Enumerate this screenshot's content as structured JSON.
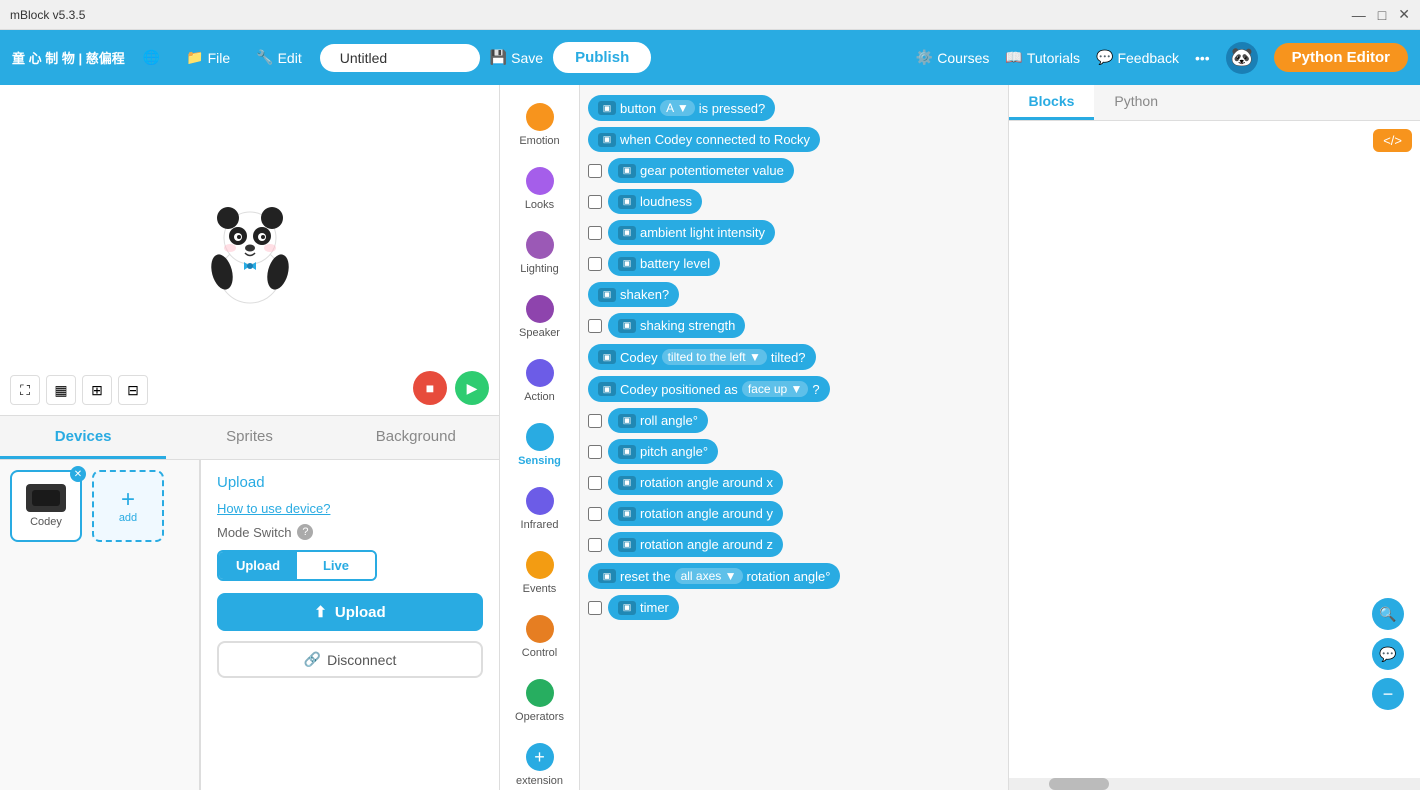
{
  "titlebar": {
    "app_name": "mBlock v5.3.5",
    "minimize": "—",
    "maximize": "□",
    "close": "✕"
  },
  "topnav": {
    "brand": "童 心 制 物 | 慈偏程",
    "globe_icon": "🌐",
    "file_label": "File",
    "edit_label": "Edit",
    "project_name": "Untitled",
    "save_label": "Save",
    "publish_label": "Publish",
    "courses_label": "Courses",
    "tutorials_label": "Tutorials",
    "feedback_label": "Feedback",
    "more_label": "•••",
    "python_editor_label": "Python Editor"
  },
  "canvas": {
    "stop_btn": "■",
    "run_btn": "▶"
  },
  "tabs": {
    "devices_label": "Devices",
    "sprites_label": "Sprites",
    "background_label": "Background"
  },
  "devices": {
    "codey_label": "Codey",
    "add_label": "add",
    "add_icon": "+"
  },
  "upload_panel": {
    "title": "Upload",
    "how_to_link": "How to use device?",
    "mode_switch": "Mode Switch",
    "upload_tab": "Upload",
    "live_tab": "Live",
    "upload_btn": "Upload",
    "disconnect_btn": "Disconnect"
  },
  "categories": [
    {
      "id": "emotion",
      "label": "Emotion",
      "color": "#f7941d"
    },
    {
      "id": "looks",
      "label": "Looks",
      "color": "#a55eea"
    },
    {
      "id": "lighting",
      "label": "Lighting",
      "color": "#9b59b6"
    },
    {
      "id": "speaker",
      "label": "Speaker",
      "color": "#8e44ad"
    },
    {
      "id": "action",
      "label": "Action",
      "color": "#6c5ce7"
    },
    {
      "id": "sensing",
      "label": "Sensing",
      "color": "#29abe2"
    },
    {
      "id": "infrared",
      "label": "Infrared",
      "color": "#6c5ce7"
    },
    {
      "id": "events",
      "label": "Events",
      "color": "#f39c12"
    },
    {
      "id": "control",
      "label": "Control",
      "color": "#e67e22"
    },
    {
      "id": "operators",
      "label": "Operators",
      "color": "#27ae60"
    },
    {
      "id": "extension",
      "label": "extension",
      "color": "#29abe2"
    }
  ],
  "blocks": [
    {
      "id": "btn-pressed",
      "type": "hat",
      "text": "button",
      "dropdown1": "A ▼",
      "extra": "is pressed?",
      "hasCheck": false
    },
    {
      "id": "when-connected",
      "type": "hat",
      "text": "when Codey connected to Rocky",
      "hasCheck": false
    },
    {
      "id": "gear-pot",
      "type": "sensing",
      "text": "gear potentiometer value",
      "hasCheck": true
    },
    {
      "id": "loudness",
      "type": "sensing",
      "text": "loudness",
      "hasCheck": true
    },
    {
      "id": "ambient",
      "type": "sensing",
      "text": "ambient light intensity",
      "hasCheck": true
    },
    {
      "id": "battery",
      "type": "sensing",
      "text": "battery level",
      "hasCheck": true
    },
    {
      "id": "shaken",
      "type": "hat",
      "text": "shaken?",
      "hasCheck": false
    },
    {
      "id": "shaking-strength",
      "type": "sensing",
      "text": "shaking strength",
      "hasCheck": true
    },
    {
      "id": "tilted",
      "type": "hat",
      "text": "Codey",
      "dropdown1": "tilted to the left ▼",
      "extra": "tilted?",
      "hasCheck": false
    },
    {
      "id": "positioned",
      "type": "hat",
      "text": "Codey positioned as",
      "dropdown1": "face up ▼",
      "extra": "?",
      "hasCheck": false
    },
    {
      "id": "roll-angle",
      "type": "sensing",
      "text": "roll angle°",
      "hasCheck": true
    },
    {
      "id": "pitch-angle",
      "type": "sensing",
      "text": "pitch angle°",
      "hasCheck": true
    },
    {
      "id": "rotation-x",
      "type": "sensing",
      "text": "rotation angle around x",
      "hasCheck": true
    },
    {
      "id": "rotation-y",
      "type": "sensing",
      "text": "rotation angle around y",
      "hasCheck": true
    },
    {
      "id": "rotation-z",
      "type": "sensing",
      "text": "rotation angle around z",
      "hasCheck": true
    },
    {
      "id": "reset-rotation",
      "type": "hat",
      "text": "reset the",
      "dropdown1": "all axes ▼",
      "extra": "rotation angle°",
      "hasCheck": false
    },
    {
      "id": "timer",
      "type": "sensing",
      "text": "timer",
      "hasCheck": true
    }
  ],
  "code_panel": {
    "blocks_tab": "Blocks",
    "python_tab": "Python",
    "snippet_btn": "</>",
    "zoom_search": "🔍",
    "zoom_comment": "💬",
    "zoom_minus": "−"
  }
}
